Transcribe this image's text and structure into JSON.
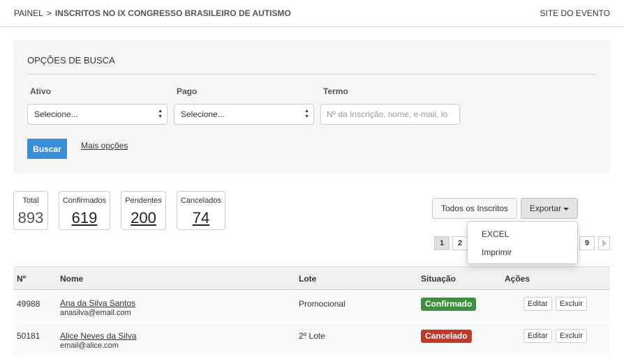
{
  "header": {
    "breadcrumb_root": "PAINEL",
    "breadcrumb_sep": ">",
    "breadcrumb_current": "INSCRITOS NO IX CONGRESSO BRASILEIRO DE AUTISMO",
    "site_link": "SITE DO EVENTO"
  },
  "search": {
    "title": "OPÇÕES DE BUSCA",
    "ativo_label": "Ativo",
    "ativo_value": "Selecione...",
    "pago_label": "Pago",
    "pago_value": "Selecione...",
    "termo_label": "Termo",
    "termo_placeholder": "Nº da Inscrição, nome, e-mail, lo",
    "button": "Buscar",
    "more_options": "Mais opções"
  },
  "stats": [
    {
      "label": "Total",
      "value": "893"
    },
    {
      "label": "Confirmados",
      "value": "619"
    },
    {
      "label": "Pendentes",
      "value": "200"
    },
    {
      "label": "Cancelados",
      "value": "74"
    }
  ],
  "actions": {
    "all_button": "Todos os Inscritos",
    "export_button": "Exportar",
    "export_menu": [
      "EXCEL",
      "Imprimir"
    ]
  },
  "pagination": {
    "visible_pages": [
      "1",
      "2",
      "9"
    ],
    "active": "1"
  },
  "table": {
    "headers": [
      "Nº",
      "Nome",
      "Lote",
      "Situação",
      "Ações"
    ],
    "rows": [
      {
        "num": "49988",
        "name": "Ana da Silva Santos",
        "email": "anasilva@email.com",
        "lote": "Promocional",
        "status": "Confirmado",
        "edit": "Editar",
        "delete": "Excluir"
      },
      {
        "num": "50181",
        "name": "Alice Neves da Silva",
        "email": "email@alice.com",
        "lote": "2º Lote",
        "status": "Cancelado",
        "edit": "Editar",
        "delete": "Excluir"
      }
    ]
  },
  "colors": {
    "primary_button": "#3a8ed8",
    "status_confirmed": "#3e8e41",
    "status_cancelled": "#c0392b"
  }
}
